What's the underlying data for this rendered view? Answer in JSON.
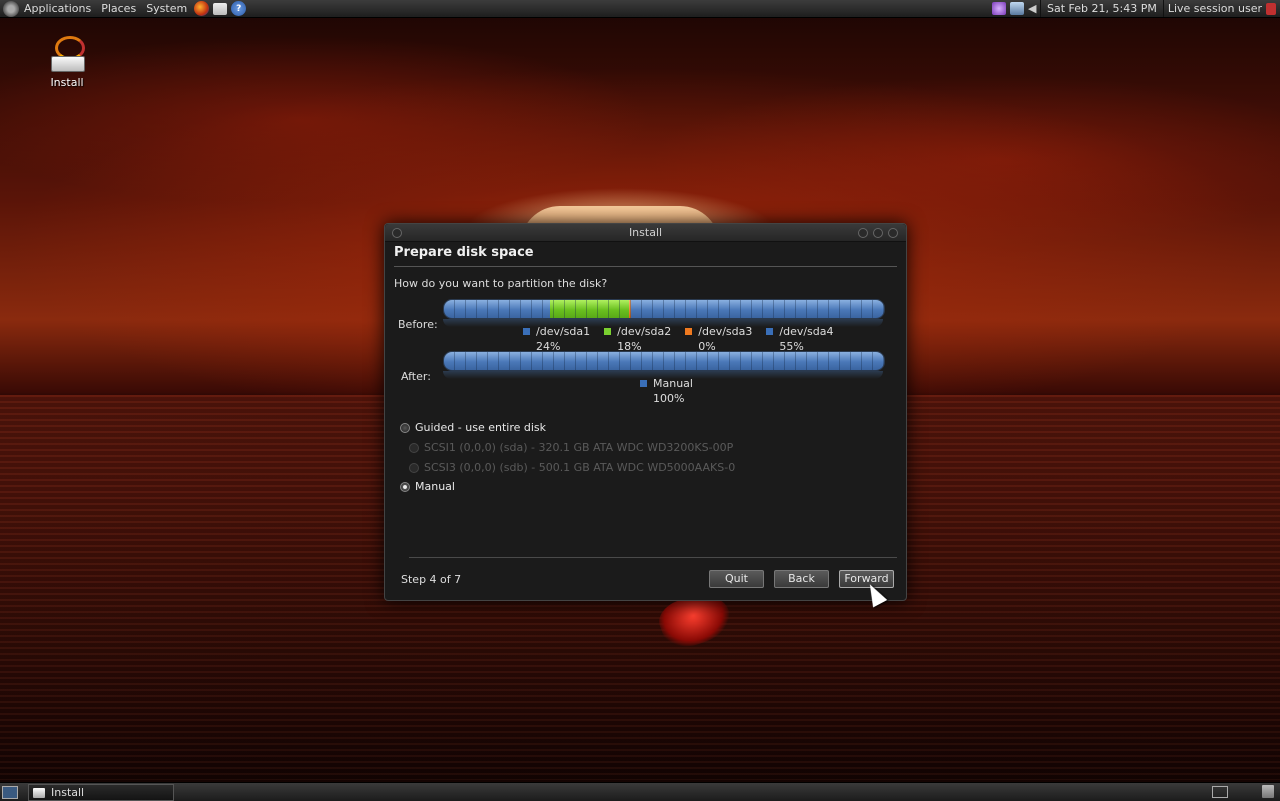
{
  "top_panel": {
    "menus": [
      "Applications",
      "Places",
      "System"
    ],
    "clock": "Sat Feb 21,  5:43 PM",
    "session": "Live session user"
  },
  "desktop": {
    "install_icon_label": "Install"
  },
  "dialog": {
    "title": "Install",
    "heading": "Prepare disk space",
    "question": "How do you want to partition the disk?",
    "before_label": "Before:",
    "after_label": "After:",
    "before_partitions": [
      {
        "name": "/dev/sda1",
        "percent": "24%",
        "fraction": 0.24,
        "color": "#3a6fb8"
      },
      {
        "name": "/dev/sda2",
        "percent": "18%",
        "fraction": 0.18,
        "color": "#7ad030"
      },
      {
        "name": "/dev/sda3",
        "percent": "0%",
        "fraction": 0.004,
        "color": "#f07a20"
      },
      {
        "name": "/dev/sda4",
        "percent": "55%",
        "fraction": 0.576,
        "color": "#3a6fb8"
      }
    ],
    "after_partitions": [
      {
        "name": "Manual",
        "percent": "100%",
        "fraction": 1.0,
        "color": "#3a6fb8"
      }
    ],
    "options": {
      "guided": "Guided - use entire disk",
      "disk1": "SCSI1 (0,0,0) (sda) - 320.1 GB ATA WDC WD3200KS-00P",
      "disk2": "SCSI3 (0,0,0) (sdb) - 500.1 GB ATA WDC WD5000AAKS-0",
      "manual": "Manual"
    },
    "selected_option": "manual",
    "step": "Step 4 of 7",
    "buttons": {
      "quit": "Quit",
      "back": "Back",
      "forward": "Forward"
    }
  },
  "bottom_panel": {
    "task_install": "Install"
  }
}
